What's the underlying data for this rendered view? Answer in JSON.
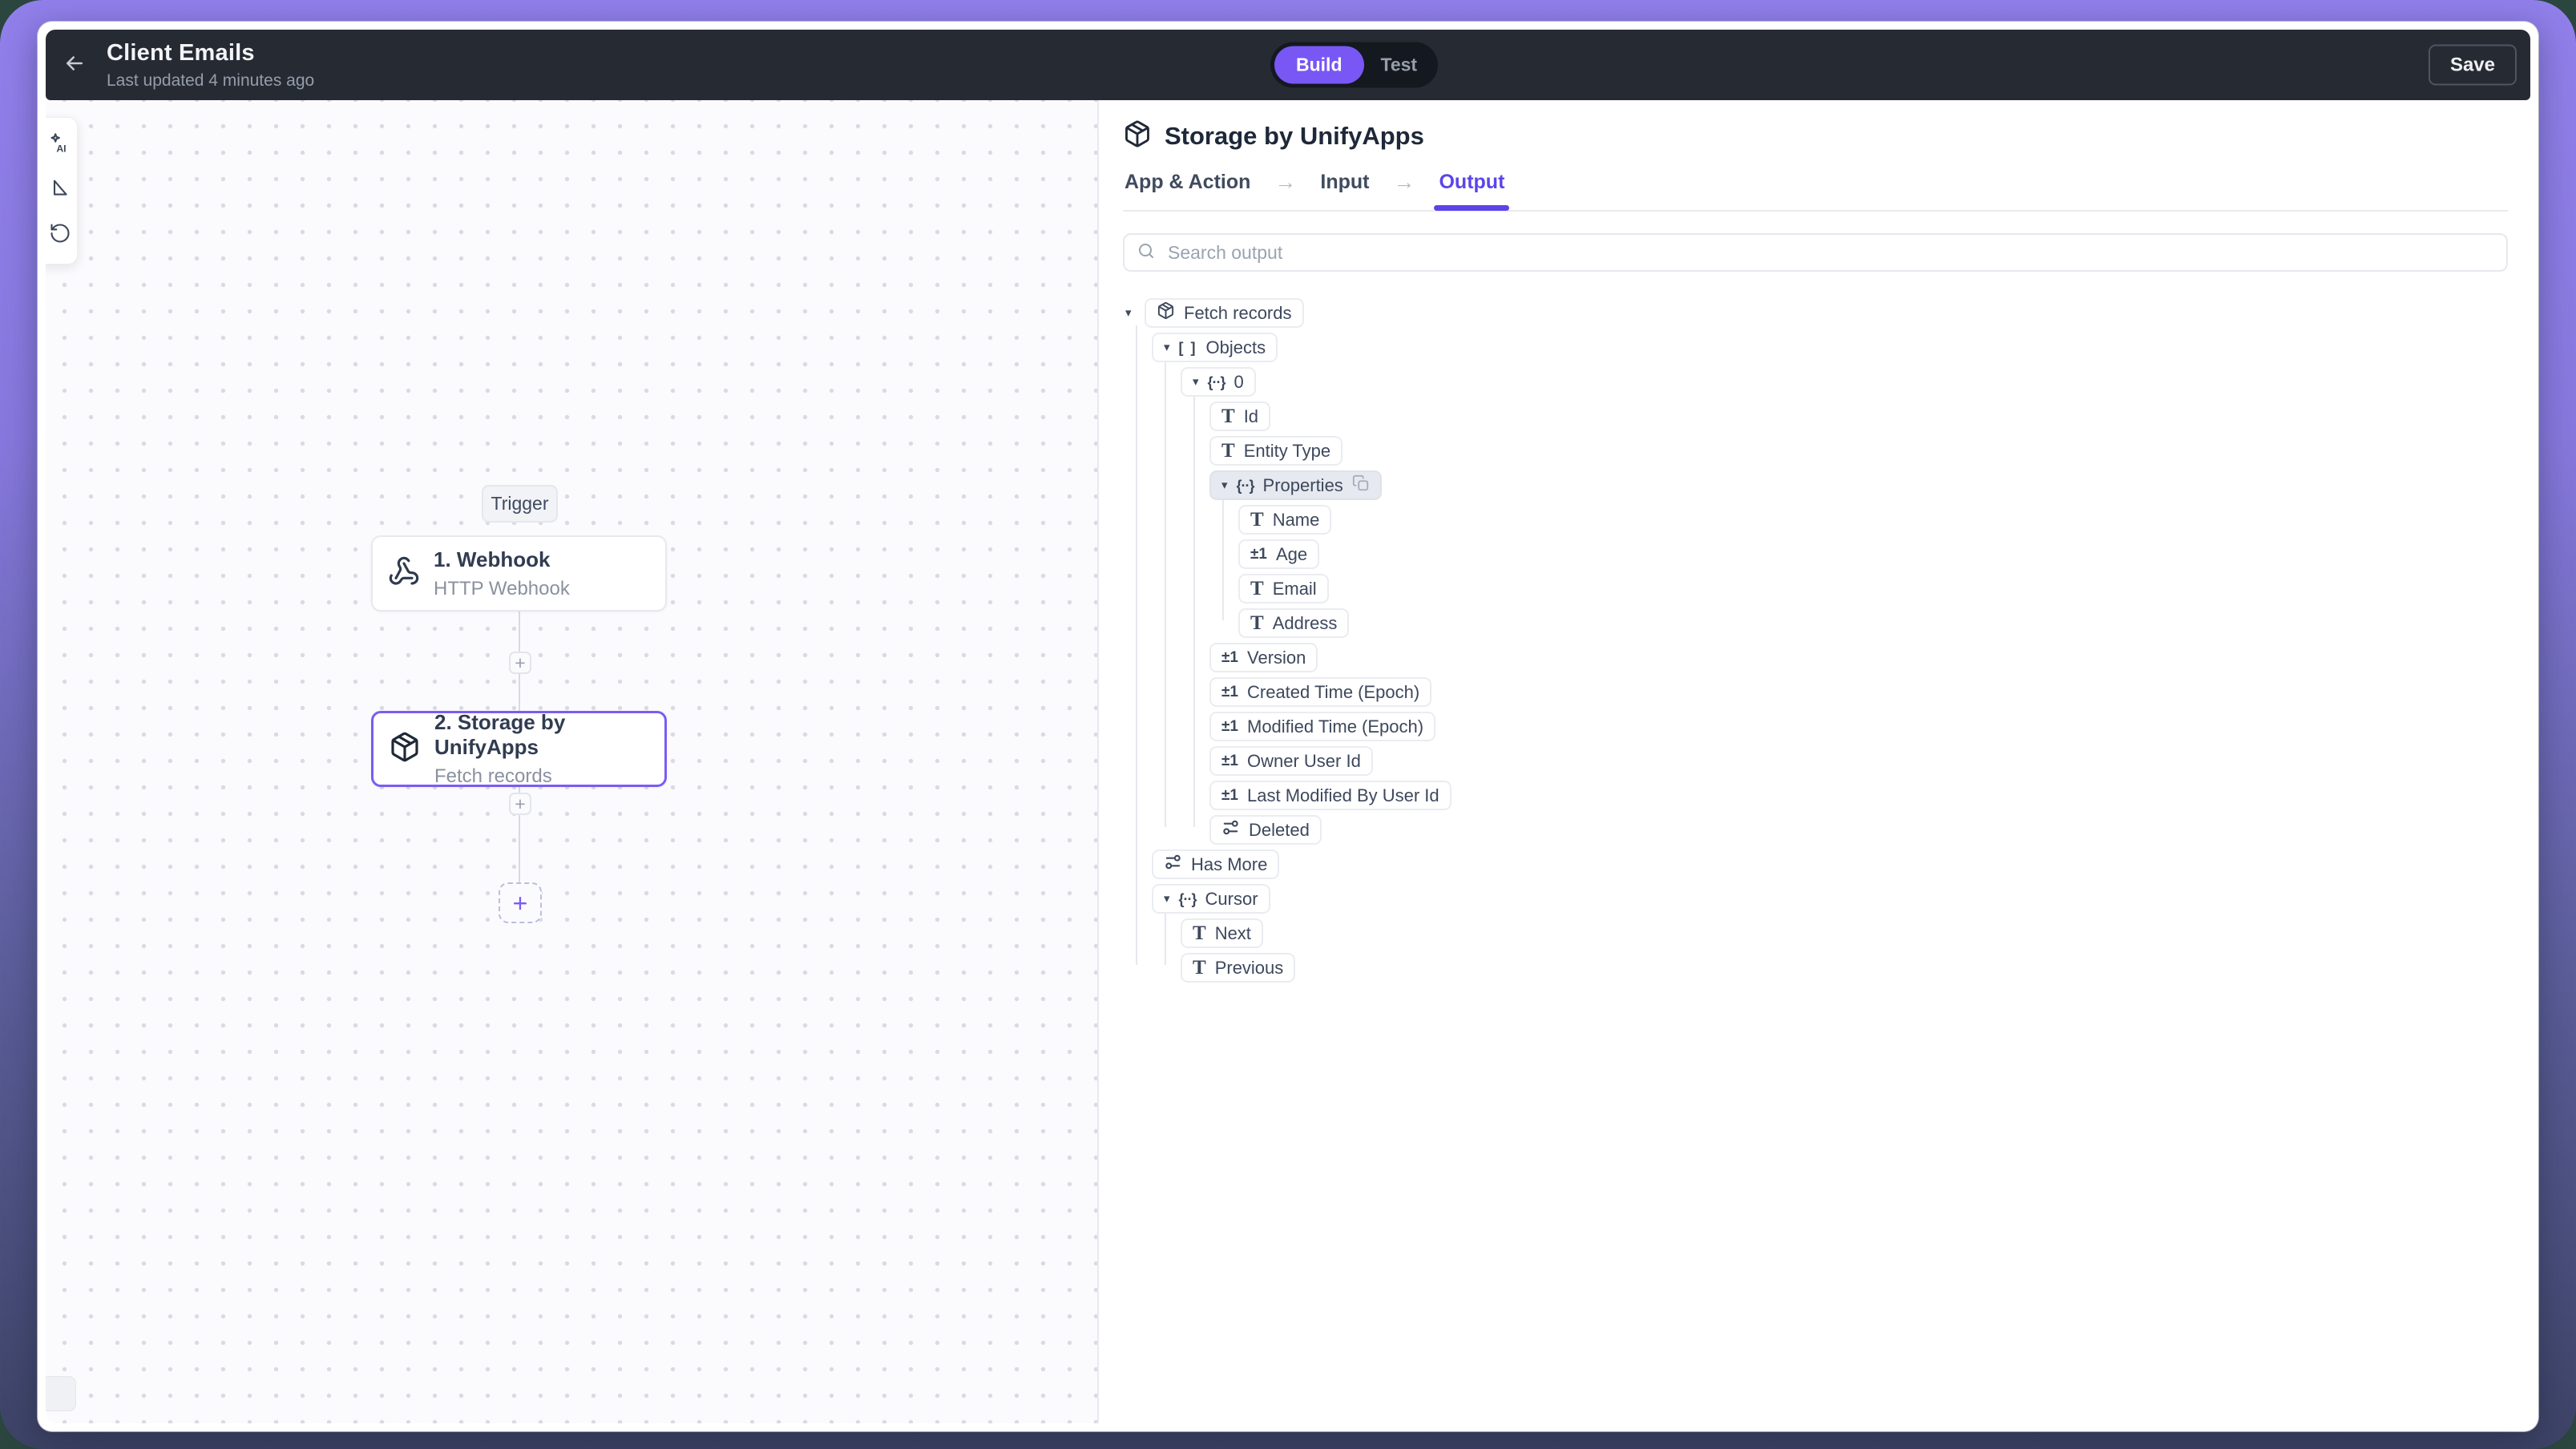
{
  "header": {
    "title": "Client Emails",
    "subtitle": "Last updated 4 minutes ago",
    "mode_toggle": {
      "build": "Build",
      "test": "Test",
      "active": "Build"
    },
    "save_label": "Save"
  },
  "canvas": {
    "trigger_label": "Trigger",
    "plus_label": "+",
    "nodes": [
      {
        "title": "1. Webhook",
        "subtitle": "HTTP Webhook",
        "icon": "webhook-icon",
        "selected": false
      },
      {
        "title": "2. Storage by UnifyApps",
        "subtitle": "Fetch records",
        "icon": "package-icon",
        "selected": true
      }
    ],
    "toolbar_icons": [
      "ai-icon",
      "select-tool-icon",
      "history-icon"
    ]
  },
  "panel": {
    "icon": "package-icon",
    "title": "Storage by UnifyApps",
    "tabs": [
      {
        "label": "App & Action",
        "active": false
      },
      {
        "label": "Input",
        "active": false
      },
      {
        "label": "Output",
        "active": true
      }
    ],
    "tab_arrow": "→",
    "search": {
      "placeholder": "Search output"
    },
    "tree": [
      {
        "label": "Fetch records",
        "level": 0,
        "type": "source",
        "caret": true
      },
      {
        "label": "Objects",
        "level": 1,
        "type": "array",
        "caret": true
      },
      {
        "label": "0",
        "level": 2,
        "type": "object",
        "caret": true
      },
      {
        "label": "Id",
        "level": 3,
        "type": "text"
      },
      {
        "label": "Entity Type",
        "level": 3,
        "type": "text"
      },
      {
        "label": "Properties",
        "level": 3,
        "type": "object",
        "caret": true,
        "highlight": true,
        "copy": true
      },
      {
        "label": "Name",
        "level": 4,
        "type": "text"
      },
      {
        "label": "Age",
        "level": 4,
        "type": "number"
      },
      {
        "label": "Email",
        "level": 4,
        "type": "text"
      },
      {
        "label": "Address",
        "level": 4,
        "type": "text"
      },
      {
        "label": "Version",
        "level": 3,
        "type": "number"
      },
      {
        "label": "Created Time (Epoch)",
        "level": 3,
        "type": "number"
      },
      {
        "label": "Modified Time (Epoch)",
        "level": 3,
        "type": "number"
      },
      {
        "label": "Owner User Id",
        "level": 3,
        "type": "number"
      },
      {
        "label": "Last Modified By User Id",
        "level": 3,
        "type": "number"
      },
      {
        "label": "Deleted",
        "level": 3,
        "type": "boolean"
      },
      {
        "label": "Has More",
        "level": 1,
        "type": "boolean"
      },
      {
        "label": "Cursor",
        "level": 1,
        "type": "object",
        "caret": true
      },
      {
        "label": "Next",
        "level": 2,
        "type": "text"
      },
      {
        "label": "Previous",
        "level": 2,
        "type": "text"
      }
    ]
  },
  "icons": {
    "back-arrow-icon": "←",
    "search-icon": "magnifier",
    "caret-down-icon": "▾",
    "text-type-icon": "T",
    "number-type-icon": "±1",
    "object-type-icon": "{··}",
    "array-type-icon": "[ ]",
    "boolean-type-icon": "sliders",
    "package-icon": "cube",
    "webhook-icon": "webhook",
    "copy-icon": "overlapping squares",
    "plus-icon": "+"
  },
  "colors": {
    "accent": "#5b45e8",
    "toggle_active": "#7857f5",
    "selected_node_border": "#7b5cf3",
    "appbar_bg": "#262a33",
    "frame_top": "#917fea",
    "frame_bottom": "#3d4366"
  }
}
